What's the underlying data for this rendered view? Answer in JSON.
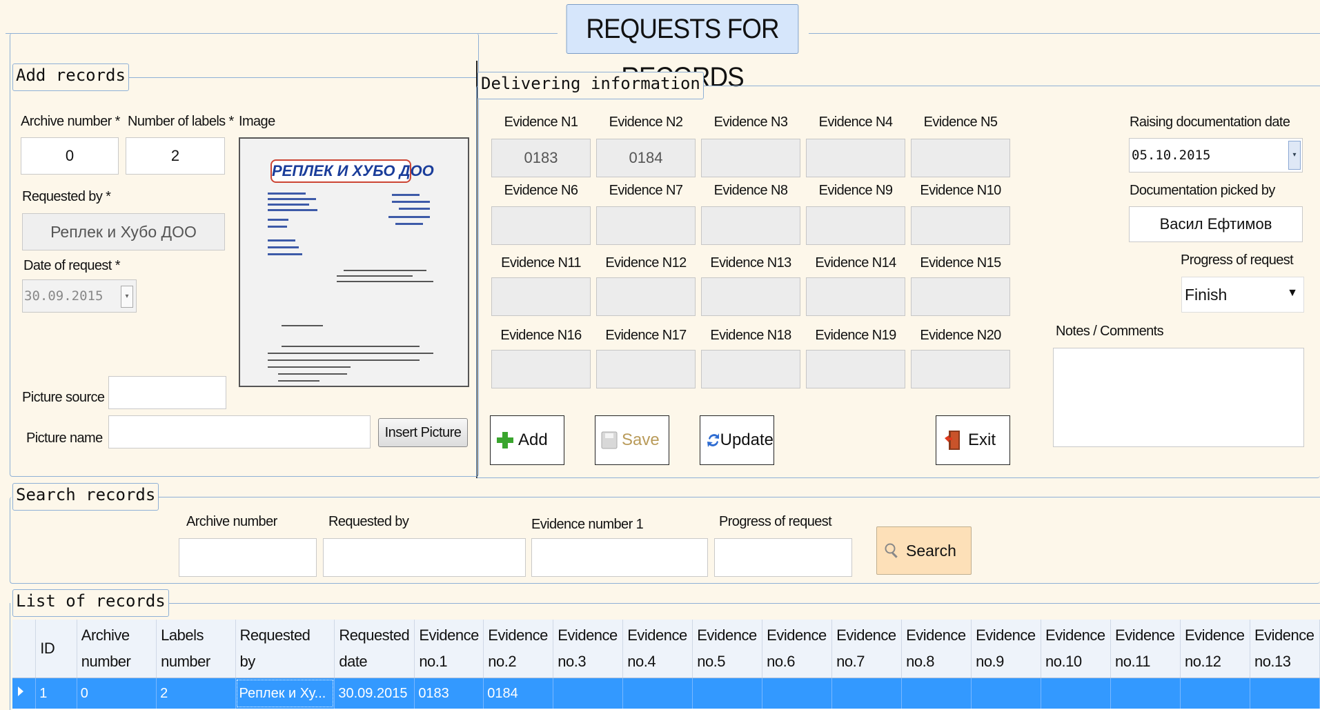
{
  "window_title": "REQUESTS FOR RECORDS",
  "add_records": {
    "legend": "Add records",
    "archive_number_label": "Archive number *",
    "archive_number_value": "0",
    "labels_label": "Number of labels *",
    "labels_value": "2",
    "image_label": "Image",
    "image_logo_text": "РЕПЛЕК И ХУБО ДОО",
    "requested_by_label": "Requested by *",
    "requested_by_value": "Реплек и Хубо ДОО",
    "date_label": "Date of request *",
    "date_value": "30.09.2015",
    "picture_source_label": "Picture source",
    "picture_source_value": "",
    "picture_name_label": "Picture name",
    "picture_name_value": "",
    "insert_picture_label": "Insert Picture"
  },
  "delivering": {
    "legend": "Delivering information",
    "evidence": [
      {
        "label": "Evidence N1",
        "value": "0183"
      },
      {
        "label": "Evidence N2",
        "value": "0184"
      },
      {
        "label": "Evidence N3",
        "value": ""
      },
      {
        "label": "Evidence N4",
        "value": ""
      },
      {
        "label": "Evidence N5",
        "value": ""
      },
      {
        "label": "Evidence N6",
        "value": ""
      },
      {
        "label": "Evidence N7",
        "value": ""
      },
      {
        "label": "Evidence N8",
        "value": ""
      },
      {
        "label": "Evidence N9",
        "value": ""
      },
      {
        "label": "Evidence N10",
        "value": ""
      },
      {
        "label": "Evidence N11",
        "value": ""
      },
      {
        "label": "Evidence N12",
        "value": ""
      },
      {
        "label": "Evidence N13",
        "value": ""
      },
      {
        "label": "Evidence N14",
        "value": ""
      },
      {
        "label": "Evidence N15",
        "value": ""
      },
      {
        "label": "Evidence N16",
        "value": ""
      },
      {
        "label": "Evidence N17",
        "value": ""
      },
      {
        "label": "Evidence N18",
        "value": ""
      },
      {
        "label": "Evidence N19",
        "value": ""
      },
      {
        "label": "Evidence N20",
        "value": ""
      }
    ],
    "raising_date_label": "Raising documentation date",
    "raising_date_value": "05.10.2015",
    "picked_by_label": "Documentation picked by",
    "picked_by_value": "Васил Ефтимов",
    "progress_label": "Progress of request",
    "progress_value": "Finish",
    "notes_label": "Notes / Comments",
    "notes_value": "",
    "buttons": {
      "add": "Add",
      "save": "Save",
      "update": "Update",
      "exit": "Exit"
    }
  },
  "search": {
    "legend": "Search records",
    "archive_label": "Archive number",
    "requested_label": "Requested by",
    "evidence_label": "Evidence number 1",
    "progress_label": "Progress of request",
    "button": "Search"
  },
  "list": {
    "legend": "List of records",
    "columns": [
      [
        "ID",
        ""
      ],
      [
        "Archive",
        "number"
      ],
      [
        "Labels",
        "number"
      ],
      [
        "Requested",
        "by"
      ],
      [
        "Requested",
        "date"
      ],
      [
        "Evidence",
        "no.1"
      ],
      [
        "Evidence",
        "no.2"
      ],
      [
        "Evidence",
        "no.3"
      ],
      [
        "Evidence",
        "no.4"
      ],
      [
        "Evidence",
        "no.5"
      ],
      [
        "Evidence",
        "no.6"
      ],
      [
        "Evidence",
        "no.7"
      ],
      [
        "Evidence",
        "no.8"
      ],
      [
        "Evidence",
        "no.9"
      ],
      [
        "Evidence",
        "no.10"
      ],
      [
        "Evidence",
        "no.11"
      ],
      [
        "Evidence",
        "no.12"
      ],
      [
        "Evidence",
        "no.13"
      ]
    ],
    "rows": [
      [
        "1",
        "0",
        "2",
        "Реплек и Ху...",
        "30.09.2015",
        "0183",
        "0184",
        "",
        "",
        "",
        "",
        "",
        "",
        "",
        "",
        "",
        "",
        ""
      ]
    ]
  },
  "colors": {
    "selection": "#3399ff",
    "frame": "#8eb0d6",
    "background": "#fdf7ea"
  }
}
